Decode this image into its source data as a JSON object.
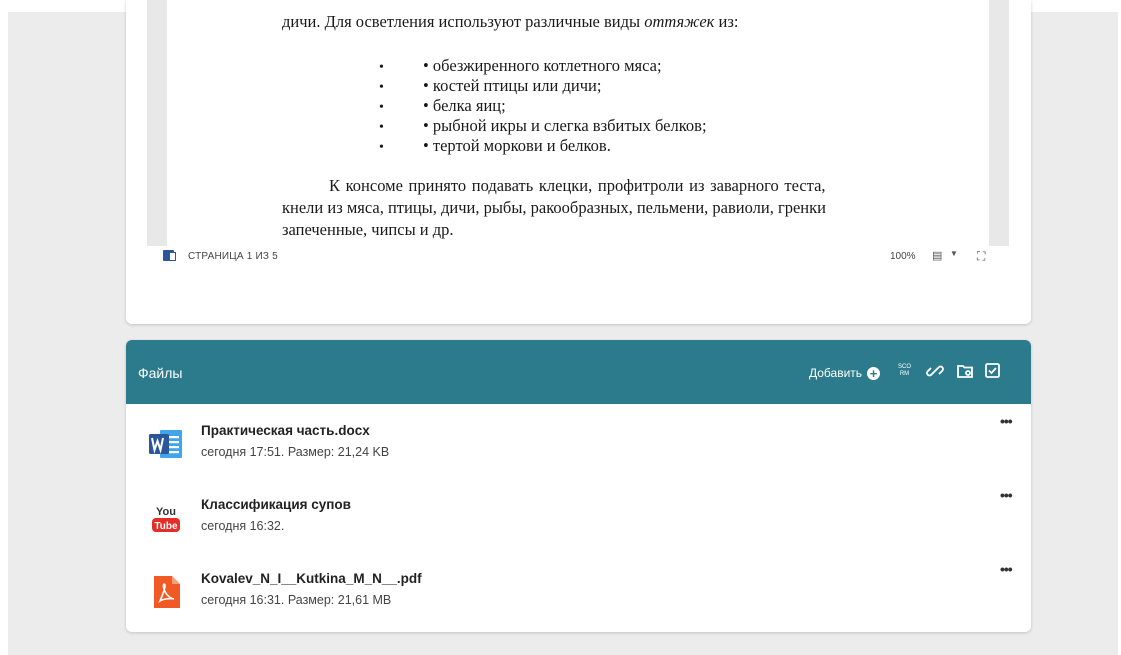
{
  "document": {
    "lines": {
      "intro_start": "дичи. Для осветления используют различные виды ",
      "intro_italic": "оттяжек",
      "intro_end": " из:"
    },
    "bullets": [
      "• обезжиренного котлетного мяса;",
      "• костей птицы или дичи;",
      "• белка яиц;",
      "• рыбной икры и слегка взбитых белков;",
      "• тертой моркови и белков."
    ],
    "bullet_marker": "•",
    "paragraph": [
      "К консоме принято подавать клецки, профитроли из заварного теста,",
      "кнели из мяса, птицы, дичи, рыбы, ракообразных, пельмени, равиоли, гренки",
      "запеченные, чипсы и др."
    ],
    "status": {
      "page_indicator": "СТРАНИЦА 1 ИЗ 5",
      "zoom": "100%"
    }
  },
  "files": {
    "title": "Файлы",
    "add_label": "Добавить",
    "scorm_label_top": "SCO",
    "scorm_label_bottom": "RM",
    "items": [
      {
        "name": "Практическая часть.docx",
        "meta": "сегодня 17:51. Размер: 21,24 KB",
        "icon": "word-doc-icon"
      },
      {
        "name": "Классификация супов",
        "meta": "сегодня 16:32.",
        "icon": "youtube-icon"
      },
      {
        "name": "Kovalev_N_I__Kutkina_M_N__.pdf",
        "meta": "сегодня 16:31. Размер: 21,61 MB",
        "icon": "pdf-icon"
      }
    ],
    "more_label": "•••"
  },
  "colors": {
    "header": "#2b7b8c",
    "word_blue": "#2b579a",
    "youtube_red": "#e52d27",
    "pdf_red": "#f15a24"
  }
}
